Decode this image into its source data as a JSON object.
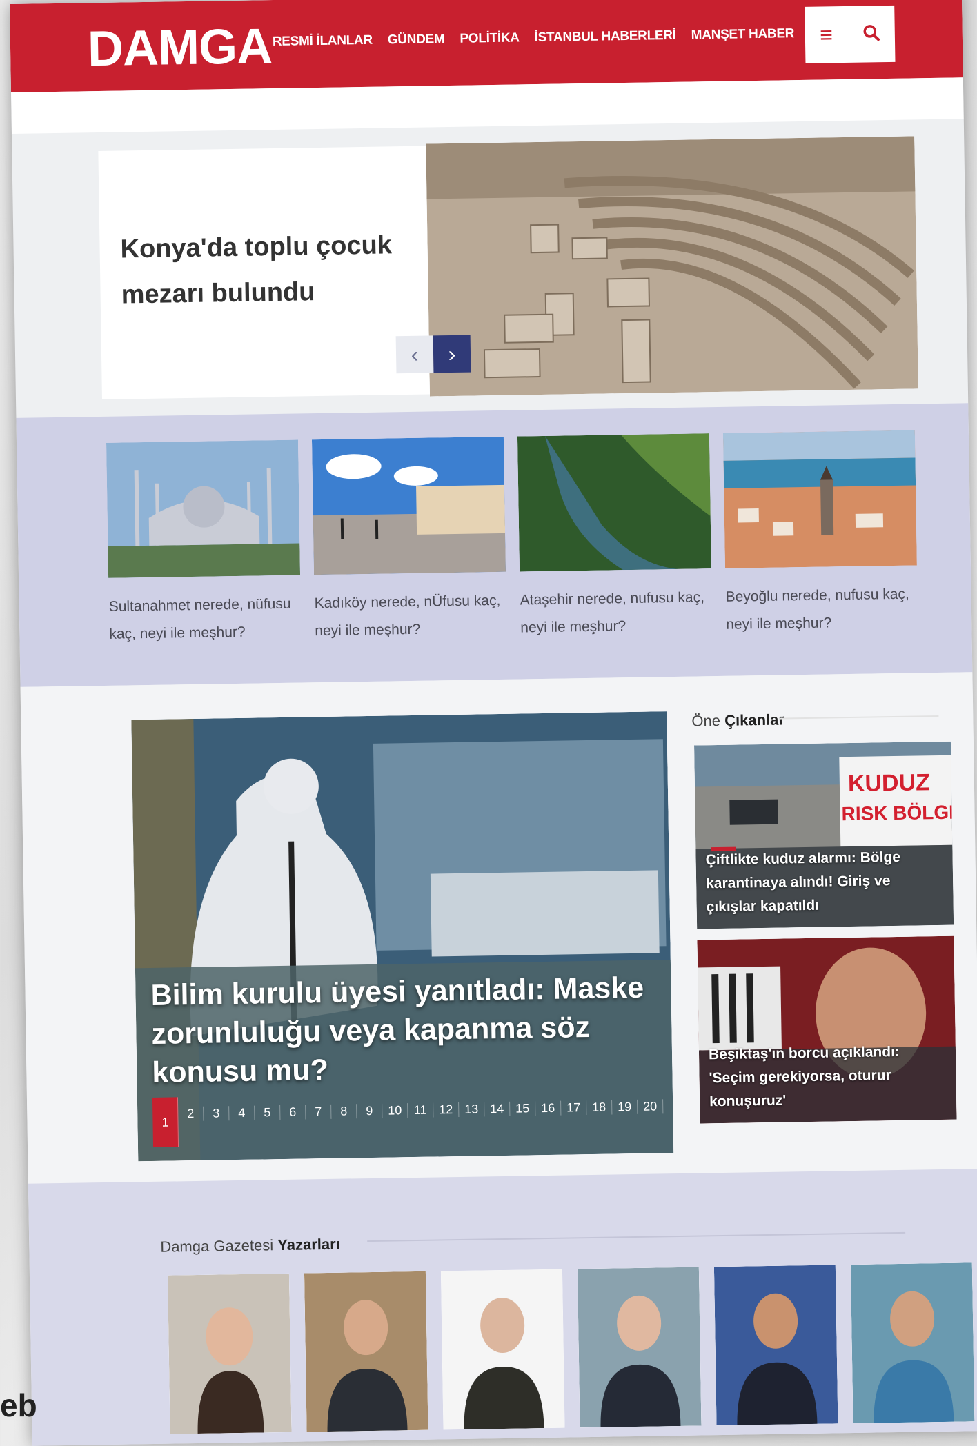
{
  "site": {
    "logo": "DAMGA",
    "nav": [
      "RESMİ İLANLAR",
      "GÜNDEM",
      "POLİTİKA",
      "İSTANBUL HABERLERİ",
      "MANŞET HABER"
    ],
    "menu_icon": "hamburger-icon",
    "search_icon": "search-icon"
  },
  "hero": {
    "title": "Konya'da toplu çocuk mezarı bulundu",
    "prev_glyph": "‹",
    "next_glyph": "›"
  },
  "strip": [
    {
      "caption": "Sultanahmet nerede, nüfusu kaç, neyi ile meşhur?"
    },
    {
      "caption": "Kadıköy nerede, nÜfusu kaç, neyi ile meşhur?"
    },
    {
      "caption": "Ataşehir nerede, nufusu kaç, neyi ile meşhur?"
    },
    {
      "caption": "Beyoğlu nerede, nufusu kaç, neyi ile meşhur?"
    }
  ],
  "main_story": {
    "title": "Bilim kurulu üyesi yanıtladı: Maske zorunluluğu veya kapanma söz konusu mu?",
    "pages": [
      "1",
      "2",
      "3",
      "4",
      "5",
      "6",
      "7",
      "8",
      "9",
      "10",
      "11",
      "12",
      "13",
      "14",
      "15",
      "16",
      "17",
      "18",
      "19",
      "20"
    ],
    "active_page": "1"
  },
  "featured": {
    "head_prefix": "Öne",
    "head_bold": "Çıkanlar",
    "sign_line1": "KUDUZ",
    "sign_line2": "RISK BÖLGESİ",
    "items": [
      {
        "caption": "Çiftlikte kuduz alarmı: Bölge karantinaya alındı! Giriş ve çıkışlar kapatıldı"
      },
      {
        "caption": "Beşiktaş'ın borcu açıklandı: 'Seçim gerekiyorsa, oturur konuşuruz'"
      }
    ]
  },
  "authors": {
    "head_prefix": "Damga Gazetesi",
    "head_bold": "Yazarları"
  },
  "corner_text": "eb",
  "colors": {
    "brand_red": "#c8202f",
    "strip_bg": "#cfd0e6",
    "nav_dark": "#303a78"
  }
}
